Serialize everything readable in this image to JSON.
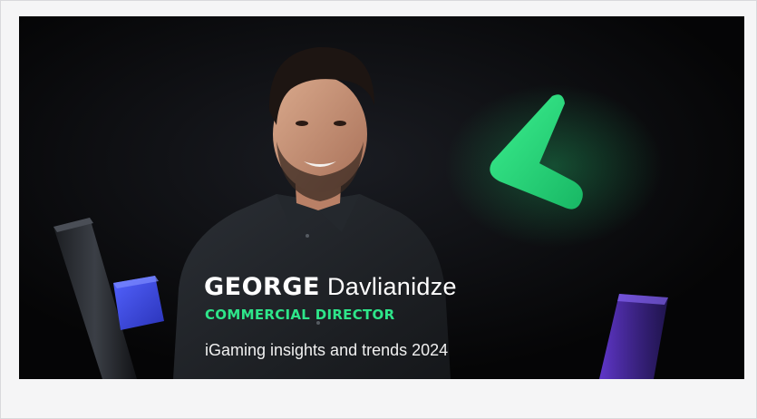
{
  "card": {
    "first_name": "GEORGE",
    "last_name": "Davlianidze",
    "role": "COMMERCIAL DIRECTOR",
    "tagline": "iGaming insights and trends 2024"
  },
  "colors": {
    "background": "#050506",
    "accent_green": "#2ee68a",
    "cube_blue": "#3d4be0",
    "page": "#f5f5f6"
  },
  "icons": [
    "green-logo-mark",
    "pillar-shape",
    "blue-cube",
    "purple-prism"
  ]
}
